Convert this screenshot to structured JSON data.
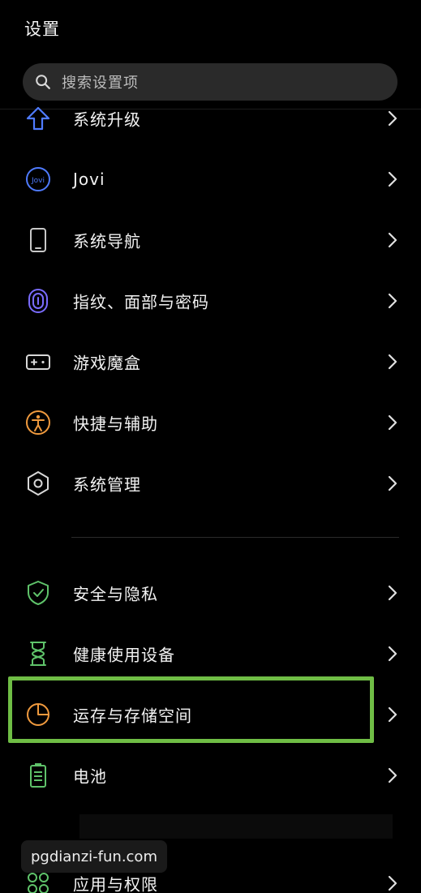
{
  "header": {
    "title": "设置"
  },
  "search": {
    "placeholder": "搜索设置项"
  },
  "settings_items": [
    {
      "label": "系统升级",
      "icon": "arrow-up-icon",
      "color": "#4f7bff"
    },
    {
      "label": "Jovi",
      "icon": "jovi-icon",
      "color": "#4f7bff"
    },
    {
      "label": "系统导航",
      "icon": "phone-icon",
      "color": "#c8c8c8"
    },
    {
      "label": "指纹、面部与密码",
      "icon": "fingerprint-icon",
      "color": "#7a6cff"
    },
    {
      "label": "游戏魔盒",
      "icon": "gamepad-icon",
      "color": "#d8d8d8"
    },
    {
      "label": "快捷与辅助",
      "icon": "accessibility-icon",
      "color": "#f09a3e"
    },
    {
      "label": "系统管理",
      "icon": "hexagon-icon",
      "color": "#d8d8d8"
    },
    {
      "label": "安全与隐私",
      "icon": "shield-icon",
      "color": "#5fc36a"
    },
    {
      "label": "健康使用设备",
      "icon": "hourglass-icon",
      "color": "#5fc36a"
    },
    {
      "label": "运存与存储空间",
      "icon": "pie-chart-icon",
      "color": "#f09a3e"
    },
    {
      "label": "电池",
      "icon": "battery-icon",
      "color": "#5fc36a"
    },
    {
      "label": "应用与权限",
      "icon": "apps-icon",
      "color": "#5fc36a"
    }
  ],
  "watermark": {
    "text": "pgdianzi-fun.com"
  },
  "highlight": {
    "target": "运存与存储空间",
    "color": "#6fbd45"
  }
}
